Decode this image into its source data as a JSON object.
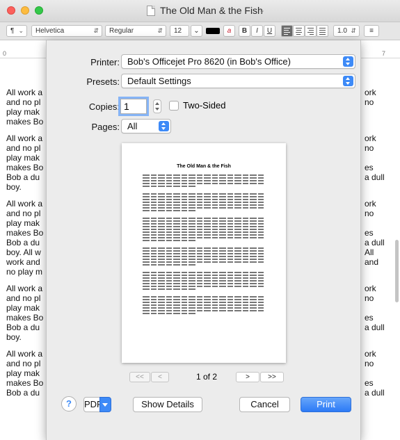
{
  "window": {
    "title": "The Old Man & the Fish"
  },
  "toolbar": {
    "paragraph_style": "¶",
    "font_family": "Helvetica",
    "font_style": "Regular",
    "font_size": "12",
    "bold": "B",
    "italic": "I",
    "underline": "U",
    "line_spacing": "1.0"
  },
  "ruler": {
    "start": "0",
    "end": "7"
  },
  "document": {
    "left_lines": [
      [
        "All work a",
        "and no pl",
        "play mak",
        "makes Bo"
      ],
      [
        "All work a",
        "and no pl",
        "play mak",
        "makes Bo",
        "Bob a du",
        "boy."
      ],
      [
        "All work a",
        "and no pl",
        "play mak",
        "makes Bo",
        "Bob a du",
        "boy. All w",
        "work and",
        "no play m"
      ],
      [
        "All work a",
        "and no pl",
        "play mak",
        "makes Bo",
        "Bob a du",
        "boy."
      ],
      [
        "All work a",
        "and no pl",
        "play mak",
        "makes Bo",
        "Bob a du"
      ]
    ],
    "right_lines": [
      [
        "ork",
        "no",
        "",
        ""
      ],
      [
        "ork",
        "no",
        "",
        "es",
        "a dull",
        ""
      ],
      [
        "ork",
        "no",
        "",
        "es",
        "a dull",
        "All",
        "and",
        ""
      ],
      [
        "ork",
        "no",
        "",
        "es",
        "a dull",
        ""
      ],
      [
        "ork",
        "no",
        "",
        "es",
        "a dull"
      ]
    ]
  },
  "print_dialog": {
    "printer_label": "Printer:",
    "printer_value": "Bob's Officejet Pro 8620 (in Bob's Office)",
    "presets_label": "Presets:",
    "presets_value": "Default Settings",
    "copies_label": "Copies:",
    "copies_value": "1",
    "two_sided_label": "Two-Sided",
    "two_sided_checked": false,
    "pages_label": "Pages:",
    "pages_value": "All",
    "preview_title": "The Old Man & the Fish",
    "page_indicator": "1 of 2",
    "nav_first": "<<",
    "nav_prev": "<",
    "nav_next": ">",
    "nav_last": ">>",
    "help_label": "?",
    "pdf_label": "PDF",
    "show_details_label": "Show Details",
    "cancel_label": "Cancel",
    "print_label": "Print"
  },
  "colors": {
    "accent": "#3d8af7",
    "focus_ring": "#86b4f6",
    "traffic_close": "#fc605c",
    "traffic_min": "#fdbc40",
    "traffic_zoom": "#34c84a"
  }
}
